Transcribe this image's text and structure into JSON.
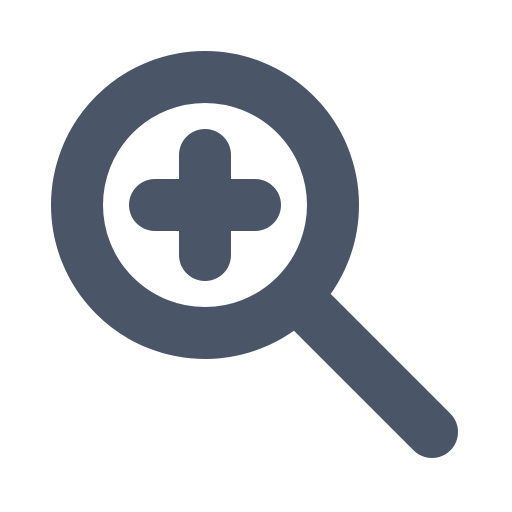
{
  "icon": {
    "name": "zoom-in-icon",
    "color": "#4a5568",
    "background": "#ffffff"
  }
}
